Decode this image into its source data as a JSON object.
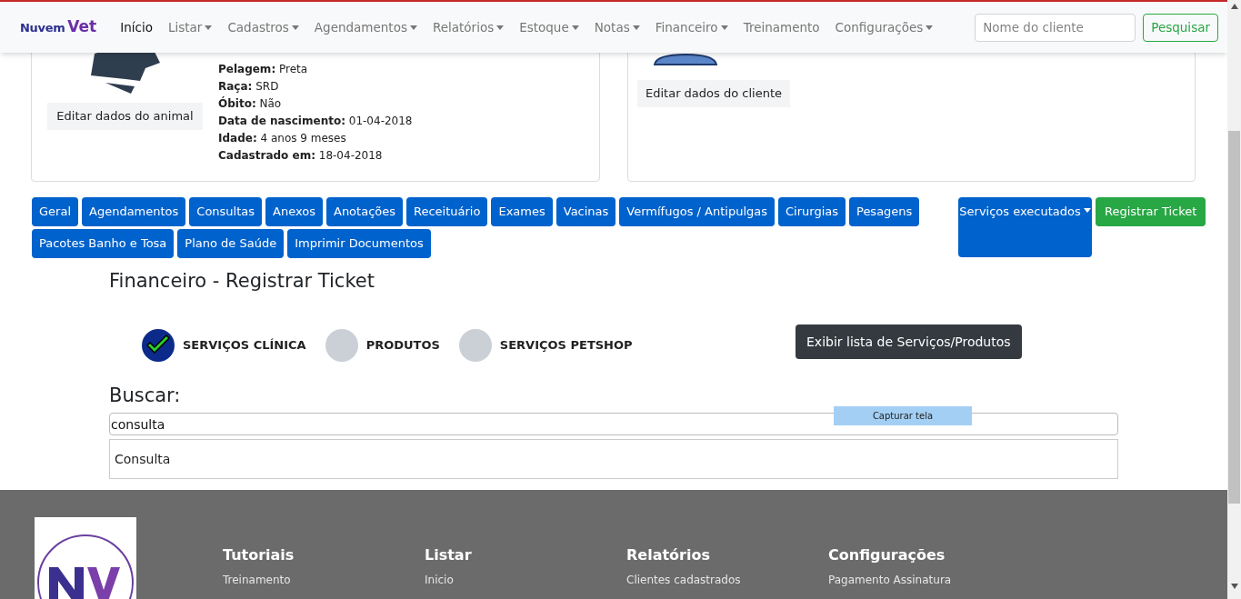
{
  "navbar": {
    "brand": {
      "part_1": "Nuvem",
      "part_2": "Vet"
    },
    "items": [
      {
        "label": "Início",
        "dropdown": false,
        "selected": true
      },
      {
        "label": "Listar",
        "dropdown": true,
        "selected": false
      },
      {
        "label": "Cadastros",
        "dropdown": true,
        "selected": false
      },
      {
        "label": "Agendamentos",
        "dropdown": true,
        "selected": false
      },
      {
        "label": "Relatórios",
        "dropdown": true,
        "selected": false
      },
      {
        "label": "Estoque",
        "dropdown": true,
        "selected": false
      },
      {
        "label": "Notas",
        "dropdown": true,
        "selected": false
      },
      {
        "label": "Financeiro",
        "dropdown": true,
        "selected": false
      },
      {
        "label": "Treinamento",
        "dropdown": false,
        "selected": false
      },
      {
        "label": "Configurações",
        "dropdown": true,
        "selected": false
      }
    ],
    "search": {
      "placeholder": "Nome do cliente",
      "button": "Pesquisar"
    }
  },
  "animal_card": {
    "edit_button": "Editar dados do animal",
    "fields": [
      {
        "label": "Pelagem:",
        "value": "Preta"
      },
      {
        "label": "Raça:",
        "value": "SRD"
      },
      {
        "label": "Óbito:",
        "value": "Não"
      },
      {
        "label": "Data de nascimento:",
        "value": "01-04-2018"
      },
      {
        "label": "Idade:",
        "value": "4 anos 9 meses"
      },
      {
        "label": "Cadastrado em:",
        "value": "18-04-2018"
      }
    ]
  },
  "client_card": {
    "edit_button": "Editar dados do cliente"
  },
  "tabs": [
    [
      "Geral",
      "Agendamentos",
      "Consultas",
      "Anexos",
      "Anotações",
      "Receituário",
      "Exames",
      "Vacinas",
      "Vermífugos / Antipulgas",
      "Cirurgias",
      "Pesagens"
    ],
    [
      "Pacotes Banho e Tosa",
      "Plano de Saúde",
      "Imprimir Documentos"
    ]
  ],
  "services_dropdown": "Serviços executados",
  "register_button": "Registrar Ticket",
  "title": "Financeiro - Registrar Ticket",
  "steps": [
    {
      "label": "SERVIÇOS CLÍNICA",
      "checked": true
    },
    {
      "label": "PRODUTOS",
      "checked": false
    },
    {
      "label": "SERVIÇOS PETSHOP",
      "checked": false
    }
  ],
  "list_button": "Exibir lista de Serviços/Produtos",
  "search": {
    "label": "Buscar:",
    "value": "consulta",
    "suggestions": [
      "Consulta"
    ]
  },
  "capture_overlay": "Capturar tela",
  "footer": {
    "columns": [
      {
        "heading": "Tutoriais",
        "link": "Treinamento"
      },
      {
        "heading": "Listar",
        "link": "Inicio"
      },
      {
        "heading": "Relatórios",
        "link": "Clientes cadastrados"
      },
      {
        "heading": "Configurações",
        "link": "Pagamento Assinatura"
      }
    ]
  }
}
